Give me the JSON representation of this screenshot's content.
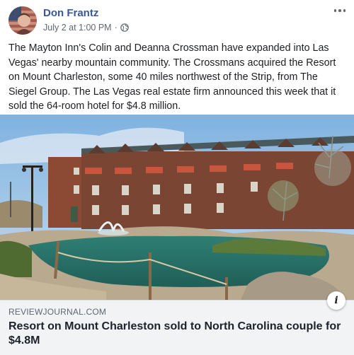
{
  "post": {
    "author": "Don Frantz",
    "timestamp": "July 2 at 1:00 PM",
    "separator": "·",
    "privacy_icon": "globe-icon",
    "more_icon": "more-options-icon",
    "text": "The Mayton Inn's Colin and Deanna Crossman have expanded into Las Vegas' nearby mountain community. The Crossmans acquired the Resort on Mount Charleston, some 40 miles northwest of the Strip, from The Siegel Group. The Las Vegas real estate firm announced this week that it sold the 64-room hotel for $4.8 million."
  },
  "link_card": {
    "domain": "REVIEWJOURNAL.COM",
    "headline": "Resort on Mount Charleston sold to North Carolina couple for $4.8M",
    "info_icon_label": "i"
  },
  "colors": {
    "author_link": "#385898",
    "meta_text": "#606770",
    "card_background": "#f2f3f5",
    "body_text": "#1c1e21"
  }
}
